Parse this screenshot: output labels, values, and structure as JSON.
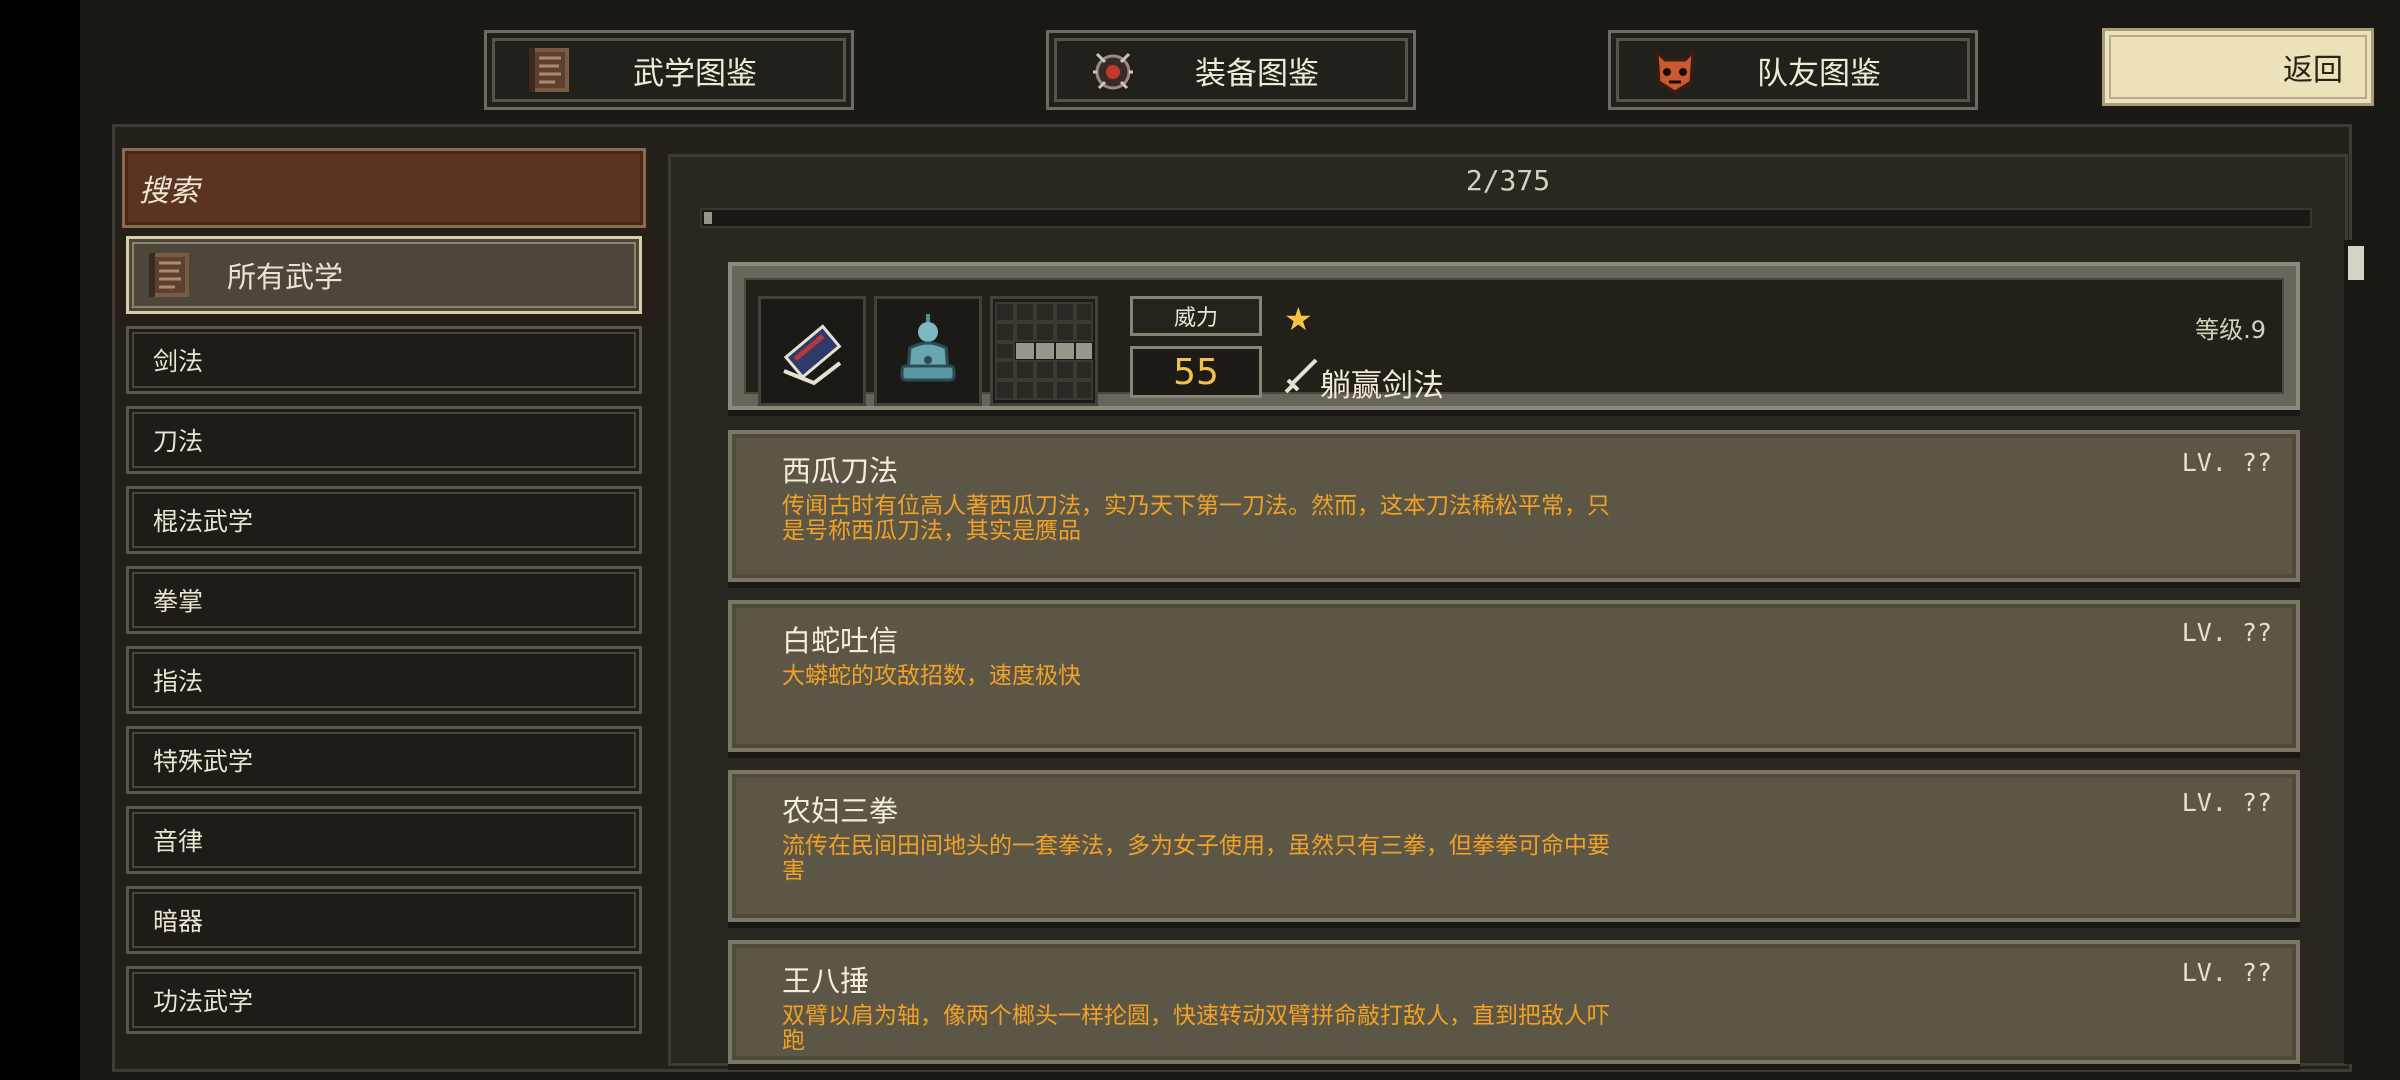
{
  "top_tabs": [
    {
      "label": "武学图鉴",
      "icon": "manual-book-icon"
    },
    {
      "label": "装备图鉴",
      "icon": "bomb-equipment-icon"
    },
    {
      "label": "队友图鉴",
      "icon": "companion-face-icon"
    }
  ],
  "back_label": "返回",
  "search_label": "搜索",
  "categories": [
    {
      "label": "所有武学",
      "selected": true
    },
    {
      "label": "剑法"
    },
    {
      "label": "刀法"
    },
    {
      "label": "棍法武学"
    },
    {
      "label": "拳掌"
    },
    {
      "label": "指法"
    },
    {
      "label": "特殊武学"
    },
    {
      "label": "音律"
    },
    {
      "label": "暗器"
    },
    {
      "label": "功法武学"
    }
  ],
  "counter": "2/375",
  "progress_fraction": 0.005,
  "featured": {
    "power_label": "威力",
    "power_value": "55",
    "rarity_stars": 1,
    "skill_name": "躺赢剑法",
    "level_text": "等级.9"
  },
  "skills": [
    {
      "title": "西瓜刀法",
      "lv": "LV. ??",
      "desc": "传闻古时有位高人著西瓜刀法，实乃天下第一刀法。然而，这本刀法稀松平常，只是号称西瓜刀法，其实是赝品"
    },
    {
      "title": "白蛇吐信",
      "lv": "LV. ??",
      "desc": "大蟒蛇的攻敌招数，速度极快"
    },
    {
      "title": "农妇三拳",
      "lv": "LV. ??",
      "desc": "流传在民间田间地头的一套拳法，多为女子使用，虽然只有三拳，但拳拳可命中要害"
    },
    {
      "title": "王八捶",
      "lv": "LV. ??",
      "desc": "双臂以肩为轴，像两个榔头一样抡圆，快速转动双臂拼命敲打敌人，直到把敌人吓跑"
    }
  ],
  "colors": {
    "accent_orange": "#f0a126",
    "power_gold": "#f2c14e",
    "search_brown": "#5a3420"
  }
}
